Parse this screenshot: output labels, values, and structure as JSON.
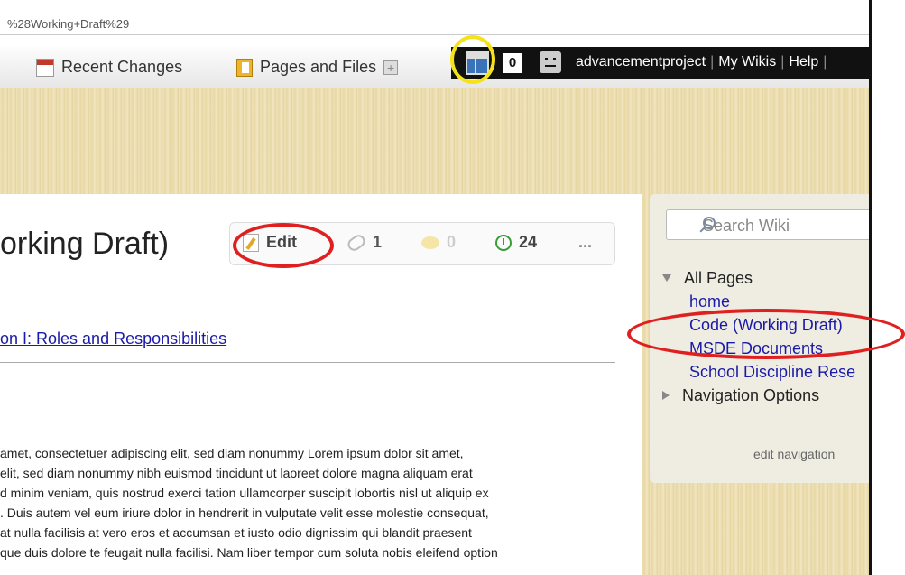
{
  "browser": {
    "url_fragment": "%28Working+Draft%29"
  },
  "toolbar": {
    "recent_changes": "Recent Changes",
    "pages_and_files": "Pages and Files"
  },
  "userbar": {
    "notification_count": "0",
    "username": "advancementproject",
    "my_wikis": "My Wikis",
    "help": "Help",
    "separator": "|"
  },
  "page": {
    "title": "orking Draft)",
    "actions": {
      "edit": "Edit",
      "links_count": "1",
      "comments_count": "0",
      "history_count": "24",
      "more": "..."
    },
    "section_link": "on I: Roles and Responsibilities",
    "body_lines": [
      "amet, consectetuer adipiscing elit, sed diam nonummy Lorem ipsum dolor sit amet,",
      "elit, sed diam nonummy nibh euismod tincidunt ut laoreet dolore magna aliquam erat",
      "d minim veniam, quis nostrud exerci tation ullamcorper suscipit lobortis nisl ut aliquip ex",
      ". Duis autem vel eum iriure dolor in hendrerit in vulputate velit esse molestie consequat,",
      "at nulla facilisis at vero eros et accumsan et iusto odio dignissim qui blandit praesent",
      "que duis dolore te feugait nulla facilisi. Nam liber tempor cum soluta nobis eleifend option"
    ]
  },
  "sidebar": {
    "search_placeholder": "Search Wiki",
    "all_pages": "All Pages",
    "pages": [
      "home",
      "Code (Working Draft)",
      "MSDE Documents",
      "School Discipline Rese"
    ],
    "navigation_options": "Navigation Options",
    "edit_navigation": "edit navigation"
  },
  "colors": {
    "annotation_red": "#e02020",
    "annotation_yellow": "#f6e21b",
    "link_blue": "#1a1aa8"
  }
}
